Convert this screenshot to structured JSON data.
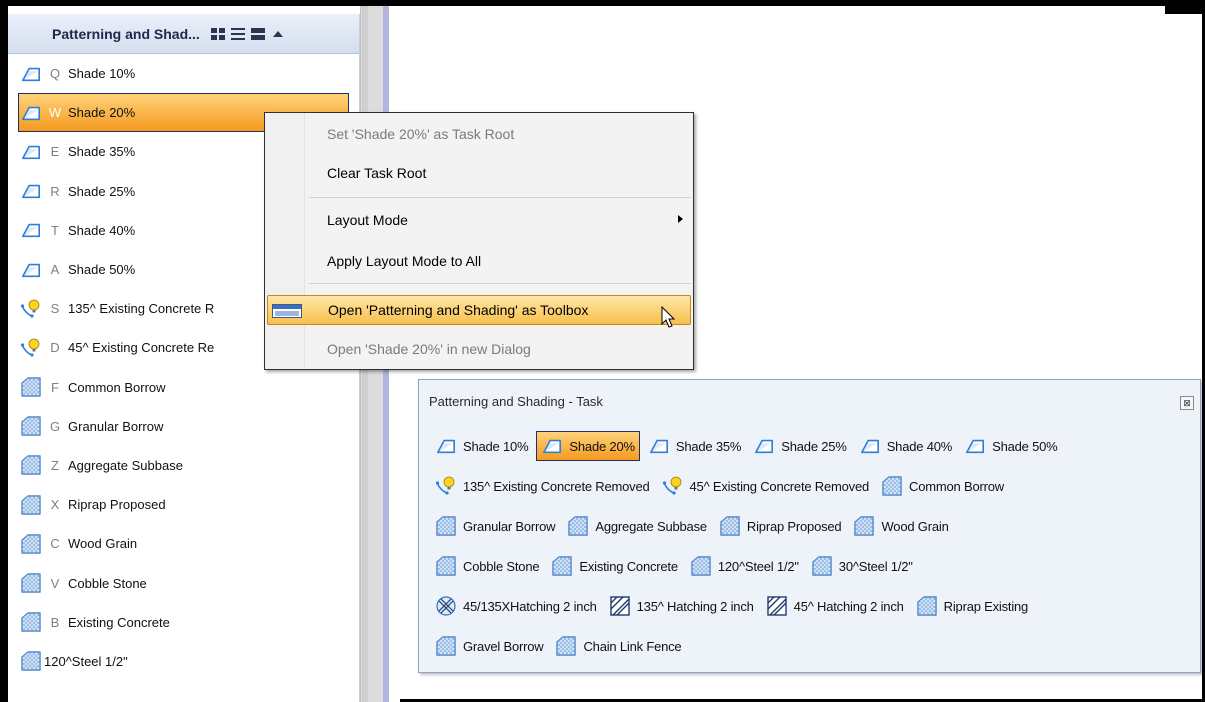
{
  "task_panel": {
    "title": "Patterning and Shad...",
    "header_buttons": [
      "grid-view-icon",
      "list-view-icon",
      "detail-view-icon",
      "collapse-icon"
    ],
    "items": [
      {
        "key": "Q",
        "label": "Shade 10%",
        "icon": "shade-icon"
      },
      {
        "key": "W",
        "label": "Shade 20%",
        "icon": "shade-icon",
        "selected": true
      },
      {
        "key": "E",
        "label": "Shade 35%",
        "icon": "shade-icon"
      },
      {
        "key": "R",
        "label": "Shade 25%",
        "icon": "shade-icon"
      },
      {
        "key": "T",
        "label": "Shade 40%",
        "icon": "shade-icon"
      },
      {
        "key": "A",
        "label": "Shade 50%",
        "icon": "shade-icon"
      },
      {
        "key": "S",
        "label": "135^ Existing Concrete R",
        "icon": "bulb-icon"
      },
      {
        "key": "D",
        "label": "45^ Existing Concrete Re",
        "icon": "bulb-icon"
      },
      {
        "key": "F",
        "label": "Common Borrow",
        "icon": "pattern-icon"
      },
      {
        "key": "G",
        "label": "Granular Borrow",
        "icon": "pattern-icon"
      },
      {
        "key": "Z",
        "label": "Aggregate Subbase",
        "icon": "pattern-icon"
      },
      {
        "key": "X",
        "label": "Riprap Proposed",
        "icon": "pattern-icon"
      },
      {
        "key": "C",
        "label": "Wood Grain",
        "icon": "pattern-icon"
      },
      {
        "key": "V",
        "label": "Cobble Stone",
        "icon": "pattern-icon"
      },
      {
        "key": "B",
        "label": "Existing Concrete",
        "icon": "pattern-icon"
      },
      {
        "key": "",
        "label": "120^Steel 1/2\"",
        "icon": "pattern-icon"
      }
    ]
  },
  "context_menu": {
    "items": [
      {
        "label": "Set 'Shade 20%' as Task Root",
        "disabled": true
      },
      {
        "label": "Clear Task Root",
        "disabled": false
      },
      {
        "label": "Layout Mode",
        "disabled": false,
        "submenu": true
      },
      {
        "label": "Apply Layout Mode to All",
        "disabled": false
      },
      {
        "label": "Open 'Patterning and Shading' as Toolbox",
        "disabled": false,
        "highlighted": true,
        "icon": "toolbox-icon"
      },
      {
        "label": "Open 'Shade 20%' in new Dialog",
        "disabled": true
      }
    ]
  },
  "toolbox": {
    "title": "Patterning and Shading - Task",
    "close_glyph": "⊠",
    "rows": [
      [
        {
          "label": "Shade 10%",
          "icon": "shade-icon"
        },
        {
          "label": "Shade 20%",
          "icon": "shade-icon",
          "selected": true
        },
        {
          "label": "Shade 35%",
          "icon": "shade-icon"
        },
        {
          "label": "Shade 25%",
          "icon": "shade-icon"
        },
        {
          "label": "Shade 40%",
          "icon": "shade-icon"
        },
        {
          "label": "Shade 50%",
          "icon": "shade-icon"
        }
      ],
      [
        {
          "label": "135^ Existing Concrete Removed",
          "icon": "bulb-icon"
        },
        {
          "label": "45^ Existing Concrete Removed",
          "icon": "bulb-icon"
        },
        {
          "label": "Common Borrow",
          "icon": "pattern-icon"
        }
      ],
      [
        {
          "label": "Granular Borrow",
          "icon": "pattern-icon"
        },
        {
          "label": "Aggregate Subbase",
          "icon": "pattern-icon"
        },
        {
          "label": "Riprap Proposed",
          "icon": "pattern-icon"
        },
        {
          "label": "Wood Grain",
          "icon": "pattern-icon"
        }
      ],
      [
        {
          "label": "Cobble Stone",
          "icon": "pattern-icon"
        },
        {
          "label": "Existing Concrete",
          "icon": "pattern-icon"
        },
        {
          "label": "120^Steel 1/2\"",
          "icon": "pattern-icon"
        },
        {
          "label": "30^Steel 1/2\"",
          "icon": "pattern-icon"
        }
      ],
      [
        {
          "label": "45/135XHatching 2 inch",
          "icon": "crosshatch-icon"
        },
        {
          "label": "135^ Hatching 2 inch",
          "icon": "hatch-icon"
        },
        {
          "label": "45^ Hatching 2 inch",
          "icon": "hatch-icon"
        },
        {
          "label": "Riprap Existing",
          "icon": "pattern-icon"
        }
      ],
      [
        {
          "label": "Gravel Borrow",
          "icon": "pattern-icon"
        },
        {
          "label": "Chain Link Fence",
          "icon": "pattern-icon"
        }
      ]
    ]
  },
  "colors": {
    "selection_top": "#ffd27a",
    "selection_bottom": "#f59a1f",
    "selection_border": "#1f2f6e",
    "icon_blue": "#2f7fd6",
    "toolbox_bg": "#eef3fa"
  }
}
